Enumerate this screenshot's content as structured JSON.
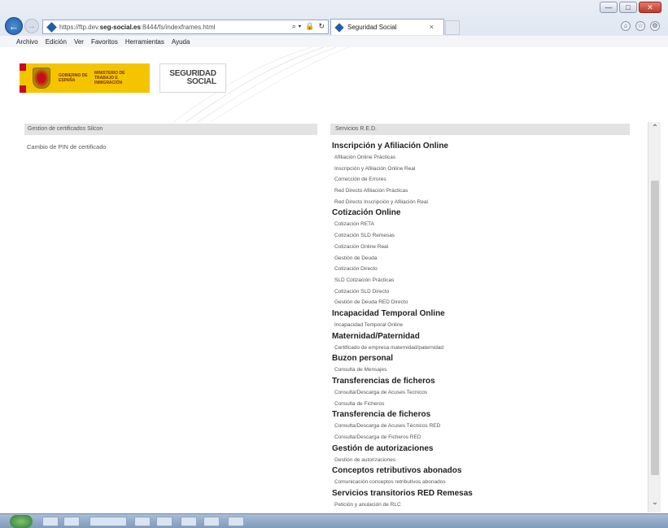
{
  "browser": {
    "window_controls": {
      "minimize": "—",
      "maximize": "□",
      "close": "✕"
    },
    "back_glyph": "←",
    "forward_glyph": "→",
    "address": {
      "scheme": "https://",
      "host_prefix": "ftp.dev.",
      "host_strong": "seg-social.es",
      "rest": ":8444/fs/indexframes.html",
      "search_glyph": "⌕ ▾",
      "lock_glyph": "🔒",
      "refresh_glyph": "↻"
    },
    "tab": {
      "title": "Seguridad Social",
      "close_glyph": "×"
    },
    "right_icons": [
      "⌂",
      "☆",
      "⚙"
    ],
    "menu": [
      "Archivo",
      "Edición",
      "Ver",
      "Favoritos",
      "Herramientas",
      "Ayuda"
    ]
  },
  "header": {
    "gov_logo": {
      "line1": "GOBIERNO DE ESPAÑA",
      "line2": "MINISTERIO DE TRABAJO E INMIGRACIÓN"
    },
    "ss_logo": {
      "line1": "SEGURIDAD",
      "line2": "SOCIAL"
    }
  },
  "left_panel": {
    "title": "Gestion de certificados Silcon",
    "link": "Cambio de PIN de certificado"
  },
  "right_panel": {
    "title": "Servicios R.E.D.",
    "sections": [
      {
        "title": "Inscripción y Afiliación Online",
        "links": [
          "Afiliación Online Prácticas",
          "Inscripción y Afiliación Online Real",
          "Corrección de Errores",
          "Red Directo Afiliación Prácticas",
          "Red Directo Inscripción y Afiliación Real"
        ]
      },
      {
        "title": "Cotización Online",
        "links": [
          "Cotización RETA",
          "Cotización SLD Remesas",
          "Cotización Online Real",
          "Gestión de Deuda",
          "Cotización Directo",
          "SLD Cotización Prácticas",
          "Cotización SLD Directo",
          "Gestión de Deuda RED Directo"
        ]
      },
      {
        "title": "Incapacidad Temporal Online",
        "links": [
          "Incapacidad Temporal Online"
        ]
      },
      {
        "title": "Maternidad/Paternidad",
        "links": [
          "Certificado de empresa maternidad/paternidad"
        ]
      },
      {
        "title": "Buzon personal",
        "links": [
          "Consulta de Mensajes"
        ]
      },
      {
        "title": "Transferencias de ficheros",
        "links": [
          "Consulta/Descarga de Acuses Tecnicos",
          "Consulta de Ficheros"
        ]
      },
      {
        "title": "Transferencia de ficheros",
        "links": [
          "Consulta/Descarga de Acuses Técnicos RED",
          "Consulta/Descarga de Ficheros RED"
        ]
      },
      {
        "title": "Gestión de autorizaciones",
        "links": [
          "Gestión de autorizaciones"
        ]
      },
      {
        "title": "Conceptos retributivos abonados",
        "links": [
          "Comunicación conceptos retributivos abonados"
        ]
      },
      {
        "title": "Servicios transitorios RED Remesas",
        "links": [
          "Petición y anulación de RLC"
        ]
      }
    ]
  },
  "scrollbar": {
    "up_glyph": "⌃",
    "down_glyph": "⌄"
  }
}
